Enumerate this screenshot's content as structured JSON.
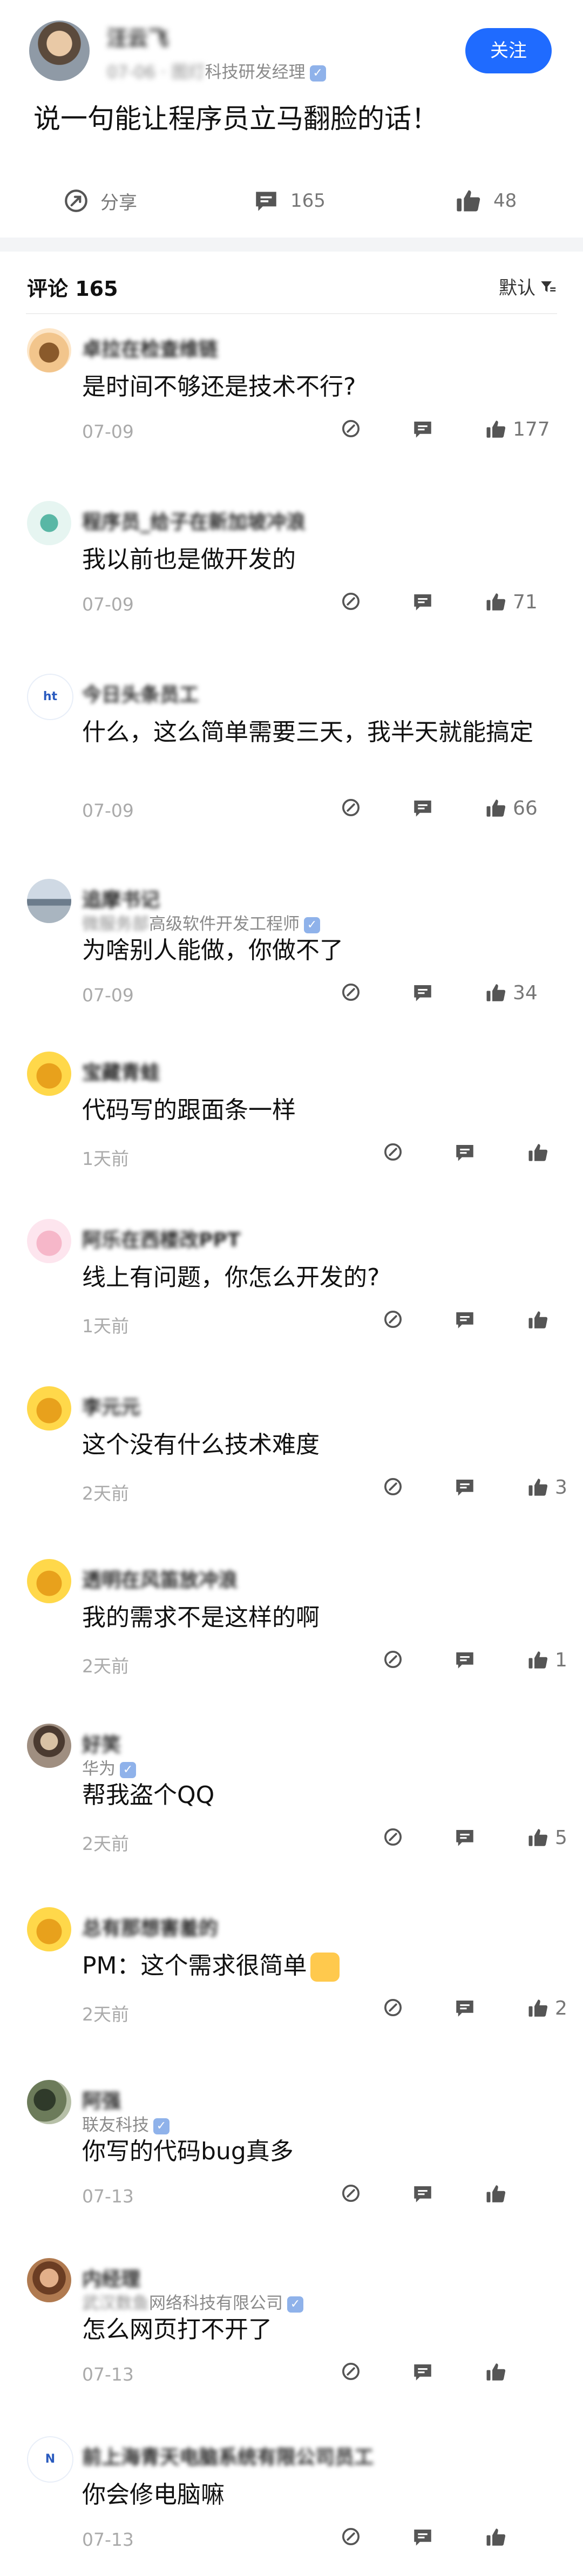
{
  "post": {
    "author_name": "汪云飞",
    "author_meta_blurred": "07-06 · 图灯",
    "author_meta_visible": "科技研发经理",
    "follow_label": "关注",
    "title": "说一句能让程序员立马翻脸的话！",
    "share_label": "分享",
    "comment_count": "165",
    "like_count": "48"
  },
  "comments_header": {
    "title": "评论 165",
    "sort_label": "默认"
  },
  "comments": [
    {
      "name": "卓拉在检查维链",
      "company": "",
      "text": "是时间不够还是技术不行?",
      "date": "07-09",
      "likes": "177"
    },
    {
      "name": "程序员_给子在新加坡冲浪",
      "company": "",
      "text": "我以前也是做开发的",
      "date": "07-09",
      "likes": "71"
    },
    {
      "name": "今日头条员工",
      "company": "",
      "text": "什么，这么简单需要三天，我半天就能搞定",
      "date": "07-09",
      "likes": "66"
    },
    {
      "name": "追摩书记",
      "company": "高级软件开发工程师",
      "company_blur": "微服务部",
      "text": "为啥别人能做，你做不了",
      "date": "07-09",
      "likes": "34"
    },
    {
      "name": "宝藏青蛙",
      "company": "",
      "text": "代码写的跟面条一样",
      "date": "1天前",
      "likes": ""
    },
    {
      "name": "阿乐在西楼改PPT",
      "company": "",
      "text": "线上有问题，你怎么开发的?",
      "date": "1天前",
      "likes": ""
    },
    {
      "name": "李元元",
      "company": "",
      "text": "这个没有什么技术难度",
      "date": "2天前",
      "likes": "3"
    },
    {
      "name": "透明在风笛放冲浪",
      "company": "",
      "text": "我的需求不是这样的啊",
      "date": "2天前",
      "likes": "1"
    },
    {
      "name": "好笑",
      "company": "华为",
      "text": "帮我盗个QQ",
      "date": "2天前",
      "likes": "5"
    },
    {
      "name": "总有那想害羞的",
      "company": "",
      "text": "PM：这个需求很简单",
      "date": "2天前",
      "likes": "2"
    },
    {
      "name": "阿强",
      "company": "联友科技",
      "text": "你写的代码bug真多",
      "date": "07-13",
      "likes": ""
    },
    {
      "name": "内经理",
      "company": "网络科技有限公司",
      "company_blur": "武汉数鱼",
      "text": "怎么网页打不开了",
      "date": "07-13",
      "likes": ""
    },
    {
      "name": "前上海青天电脑系统有限公司员工",
      "company": "",
      "text": "你会修电脑嘛",
      "date": "07-13",
      "likes": ""
    }
  ],
  "icons": {
    "share": "share-icon",
    "comment": "comment-icon",
    "like": "thumbs-up-icon",
    "sort": "filter-icon",
    "verified": "verified-badge-icon"
  },
  "colors": {
    "accent": "#1f6bff",
    "gray_text": "#8a8a8a",
    "icon_gray": "#555555"
  }
}
